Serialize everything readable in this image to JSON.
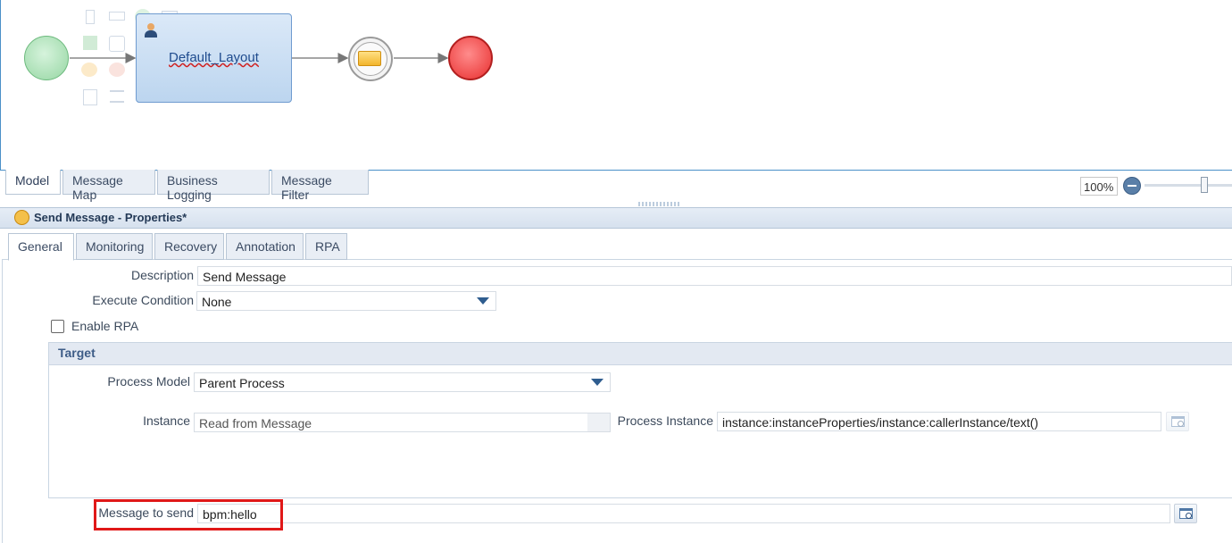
{
  "canvas": {
    "task_label": "Default_Layout"
  },
  "model_tabs": [
    "Model",
    "Message Map",
    "Business Logging",
    "Message Filter"
  ],
  "zoom": {
    "value": "100%"
  },
  "properties": {
    "title": "Send Message - Properties*",
    "tabs": [
      "General",
      "Monitoring",
      "Recovery",
      "Annotation",
      "RPA"
    ],
    "fields": {
      "description": {
        "label": "Description",
        "value": "Send Message"
      },
      "execute_condition": {
        "label": "Execute Condition",
        "value": "None"
      },
      "enable_rpa": {
        "label": "Enable RPA",
        "checked": false
      }
    },
    "target": {
      "title": "Target",
      "process_model": {
        "label": "Process Model",
        "value": "Parent Process"
      },
      "instance": {
        "label": "Instance",
        "value": "Read from Message"
      },
      "process_instance": {
        "label": "Process Instance",
        "value": "instance:instanceProperties/instance:callerInstance/text()"
      }
    },
    "message_to_send": {
      "label": "Message to send",
      "value": "bpm:hello"
    }
  },
  "colors": {
    "highlight": "#e01818",
    "start_event": "#a9dfb4",
    "end_event": "#ef4b4b",
    "task": "#bcd5ef"
  }
}
